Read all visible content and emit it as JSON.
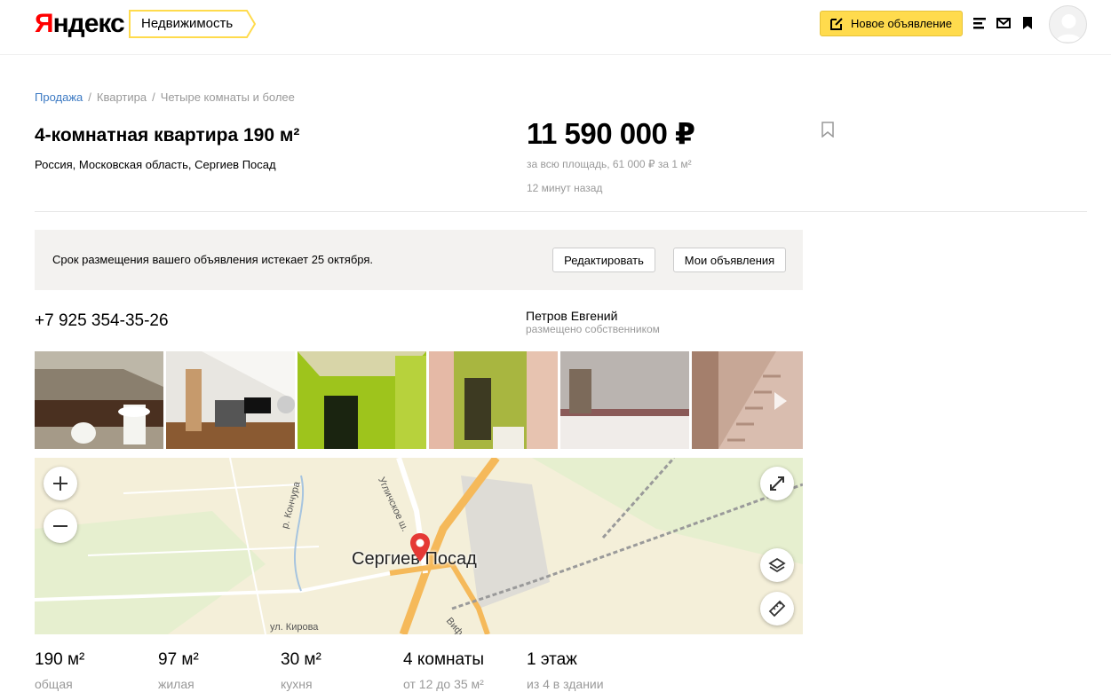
{
  "header": {
    "logo_first": "Я",
    "logo_rest": "ндекс",
    "service": "Недвижимость",
    "new_ad": "Новое объявление"
  },
  "breadcrumb": {
    "items": [
      "Продажа",
      "Квартира",
      "Четыре комнаты и более"
    ]
  },
  "listing": {
    "title": "4-комнатная квартира 190 м²",
    "address": "Россия, Московская область, Сергиев Посад",
    "price": "11 590 000 ₽",
    "price_detail": "за всю площадь, 61 000 ₽ за 1 м²",
    "published": "12 минут назад"
  },
  "notice": {
    "text": "Срок размещения вашего объявления истекает 25 октября.",
    "edit": "Редактировать",
    "my_ads": "Мои объявления"
  },
  "contact": {
    "phone": "+7 925 354-35-26",
    "seller": "Петров Евгений",
    "seller_note": "размещено собственником"
  },
  "map": {
    "city": "Сергиев Посад",
    "label_road": "Угличское ш.",
    "label_river": "р. Кончура",
    "label_street": "ул. Кирова",
    "label_vif": "Виф"
  },
  "stats": [
    {
      "value": "190 м²",
      "label": "общая"
    },
    {
      "value": "97 м²",
      "label": "жилая"
    },
    {
      "value": "30 м²",
      "label": "кухня"
    },
    {
      "value": "4 комнаты",
      "label": "от 12 до 35 м²"
    },
    {
      "value": "1 этаж",
      "label": "из 4 в здании"
    }
  ],
  "colors": {
    "accent_yellow": "#ffdb4d",
    "link_blue": "#3b79c3",
    "logo_red": "#ff0000"
  }
}
